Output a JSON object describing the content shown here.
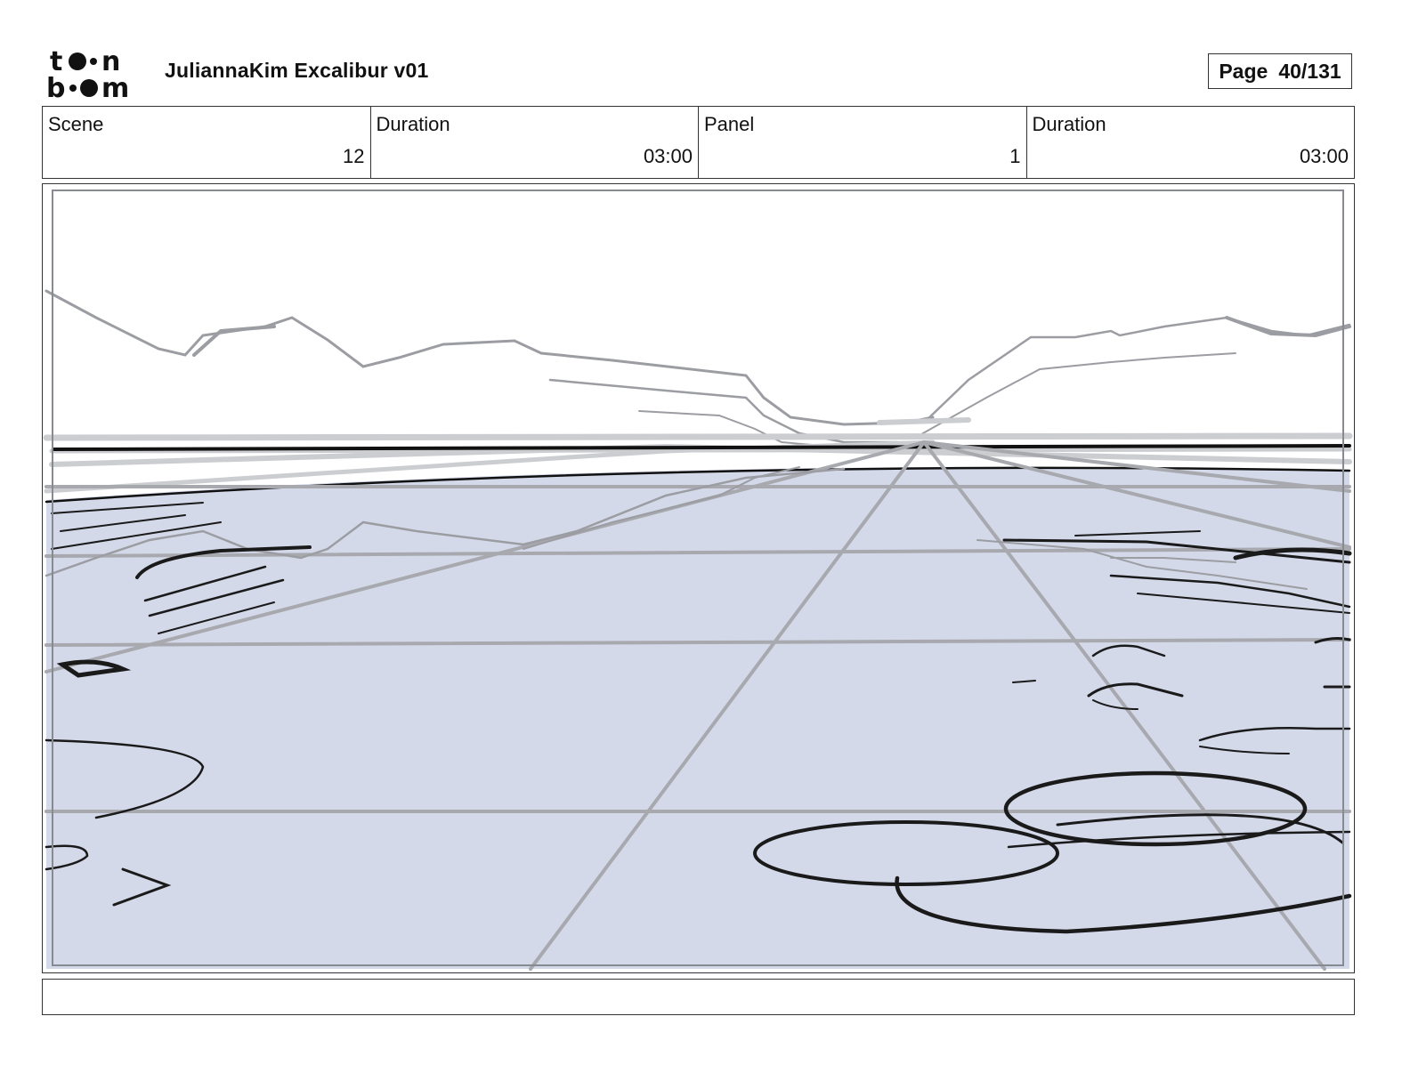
{
  "header": {
    "logo_text": "toon boom",
    "title": "JuliannaKim Excalibur v01",
    "page_label": "Page",
    "page_value": "40/131"
  },
  "info": {
    "scene_label": "Scene",
    "scene_value": "12",
    "scene_duration_label": "Duration",
    "scene_duration_value": "03:00",
    "panel_label": "Panel",
    "panel_value": "1",
    "panel_duration_label": "Duration",
    "panel_duration_value": "03:00"
  },
  "colors": {
    "ground_fill": "#d4d9ea",
    "sketch_gray": "#a7a9ae",
    "sketch_dark": "#1a1a1a",
    "frame_border": "#888a92"
  },
  "notes": {
    "text": ""
  }
}
